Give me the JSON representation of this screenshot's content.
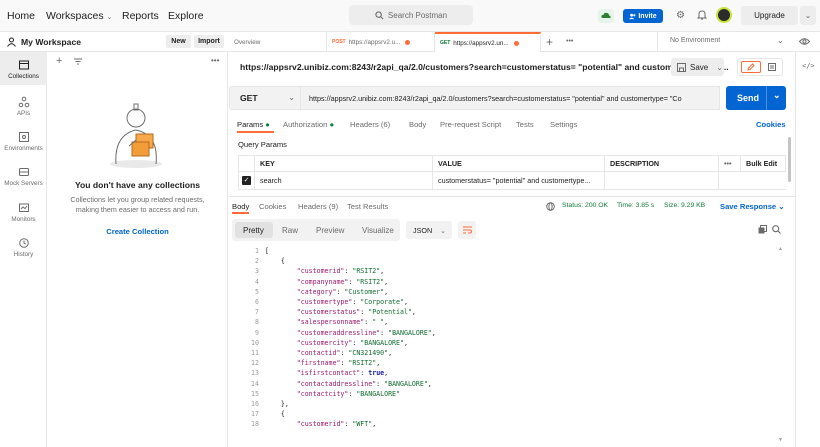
{
  "topbar": {
    "nav": [
      "Home",
      "Workspaces",
      "Reports",
      "Explore"
    ],
    "search_placeholder": "Search Postman",
    "invite_label": "Invite",
    "upgrade_label": "Upgrade"
  },
  "rail": [
    {
      "label": "Collections",
      "icon": "collections-icon"
    },
    {
      "label": "APIs",
      "icon": "apis-icon"
    },
    {
      "label": "Environments",
      "icon": "environments-icon"
    },
    {
      "label": "Mock Servers",
      "icon": "mock-servers-icon"
    },
    {
      "label": "Monitors",
      "icon": "monitors-icon"
    },
    {
      "label": "History",
      "icon": "history-icon"
    }
  ],
  "sidebar": {
    "workspace_title": "My Workspace",
    "new_label": "New",
    "import_label": "Import",
    "empty_title": "You don't have any collections",
    "empty_desc": "Collections let you group related requests, making them easier to access and run.",
    "create_label": "Create Collection"
  },
  "tabs": {
    "overview": "Overview",
    "tab1_method": "POST",
    "tab1_url": "https://appsrv2.u...",
    "tab2_method": "GET",
    "tab2_url": "https://appsrv2.un...",
    "environment": "No Environment"
  },
  "request": {
    "title": "https://appsrv2.unibiz.com:8243/r2api_qa/2.0/customers?search=customerstatus= \"potential\" and customertype= \"Co...",
    "save_label": "Save",
    "method": "GET",
    "url": "https://appsrv2.unibiz.com:8243/r2api_qa/2.0/customers?search=customerstatus= \"potential\" and customertype= \"Co",
    "send_label": "Send",
    "tabs": [
      "Params",
      "Authorization",
      "Headers (6)",
      "Body",
      "Pre-request Script",
      "Tests",
      "Settings"
    ],
    "cookies_label": "Cookies",
    "query_params_label": "Query Params",
    "columns": [
      "KEY",
      "VALUE",
      "DESCRIPTION",
      "•••",
      "Bulk Edit"
    ],
    "rows": [
      {
        "key": "search",
        "value": "customerstatus= \"potential\" and customertype..."
      }
    ]
  },
  "response": {
    "tabs": [
      "Body",
      "Cookies",
      "Headers (9)",
      "Test Results"
    ],
    "status": "Status: 200 OK",
    "time": "Time: 3.85 s",
    "size": "Size: 9.29 KB",
    "save_response": "Save Response",
    "modes": [
      "Pretty",
      "Raw",
      "Preview",
      "Visualize"
    ],
    "format": "JSON"
  },
  "code_lines": [
    {
      "n": "1",
      "t": "["
    },
    {
      "n": "2",
      "t": "    {"
    },
    {
      "n": "3",
      "k": "\"customerid\"",
      "v": "\"RSIT2\"",
      "type": "s",
      "ind": 8
    },
    {
      "n": "4",
      "k": "\"companyname\"",
      "v": "\"RSIT2\"",
      "type": "s",
      "ind": 8
    },
    {
      "n": "5",
      "k": "\"category\"",
      "v": "\"Customer\"",
      "type": "s",
      "ind": 8
    },
    {
      "n": "6",
      "k": "\"customertype\"",
      "v": "\"Corporate\"",
      "type": "s",
      "ind": 8
    },
    {
      "n": "7",
      "k": "\"customerstatus\"",
      "v": "\"Potential\"",
      "type": "s",
      "ind": 8
    },
    {
      "n": "8",
      "k": "\"salespersonname\"",
      "v": "\" \"",
      "type": "s",
      "ind": 8
    },
    {
      "n": "9",
      "k": "\"customeraddressline\"",
      "v": "\"BANGALORE\"",
      "type": "s",
      "ind": 8
    },
    {
      "n": "10",
      "k": "\"customercity\"",
      "v": "\"BANGALORE\"",
      "type": "s",
      "ind": 8
    },
    {
      "n": "11",
      "k": "\"contactid\"",
      "v": "\"CN321490\"",
      "type": "s",
      "ind": 8
    },
    {
      "n": "12",
      "k": "\"firstname\"",
      "v": "\"RSIT2\"",
      "type": "s",
      "ind": 8
    },
    {
      "n": "13",
      "k": "\"isfirstcontact\"",
      "v": "true",
      "type": "b",
      "ind": 8
    },
    {
      "n": "14",
      "k": "\"contactaddressline\"",
      "v": "\"BANGALORE\"",
      "type": "s",
      "ind": 8
    },
    {
      "n": "15",
      "k": "\"contactcity\"",
      "v": "\"BANGALORE\"",
      "type": "s",
      "ind": 8,
      "last": true
    },
    {
      "n": "16",
      "t": "    },"
    },
    {
      "n": "17",
      "t": "    {"
    },
    {
      "n": "18",
      "k": "\"customerid\"",
      "v": "\"WFT\"",
      "type": "s",
      "ind": 8
    }
  ],
  "colors": {
    "accent": "#ff6c37",
    "primary": "#0265d2",
    "status_ok": "#0f7b36"
  }
}
